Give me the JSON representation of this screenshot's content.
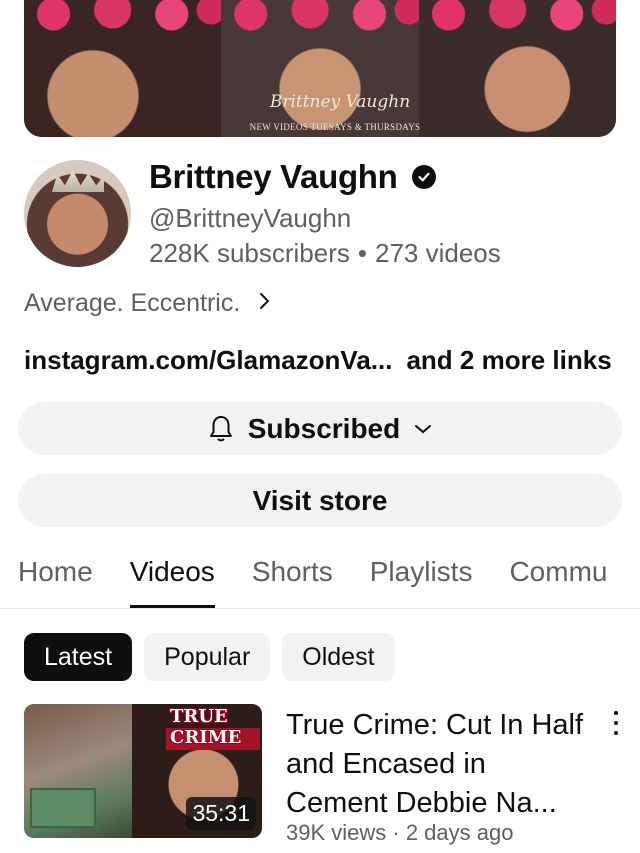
{
  "banner": {
    "name": "Brittney Vaughn",
    "tagline": "NEW VIDEOS TUESAYS & THURSDAYS"
  },
  "channel": {
    "name": "Brittney Vaughn",
    "handle": "@BrittneyVaughn",
    "subscribers": "228K subscribers",
    "videos": "273 videos",
    "separator": "•",
    "description": "Average. Eccentric.",
    "link": "instagram.com/GlamazonVa...",
    "more_links": "and 2 more links"
  },
  "buttons": {
    "subscribed": "Subscribed",
    "visit_store": "Visit store"
  },
  "tabs": [
    "Home",
    "Videos",
    "Shorts",
    "Playlists",
    "Commu"
  ],
  "chips": [
    "Latest",
    "Popular",
    "Oldest"
  ],
  "video": {
    "title": "True Crime: Cut In Half and Encased in Cement  Debbie Na...",
    "meta": "39K views · 2 days ago",
    "duration": "35:31",
    "thumb_text": "TRUE CRIME"
  },
  "colors": {
    "text_primary": "#0f0f0f",
    "text_secondary": "#606060",
    "chip_bg": "#f2f2f2"
  }
}
